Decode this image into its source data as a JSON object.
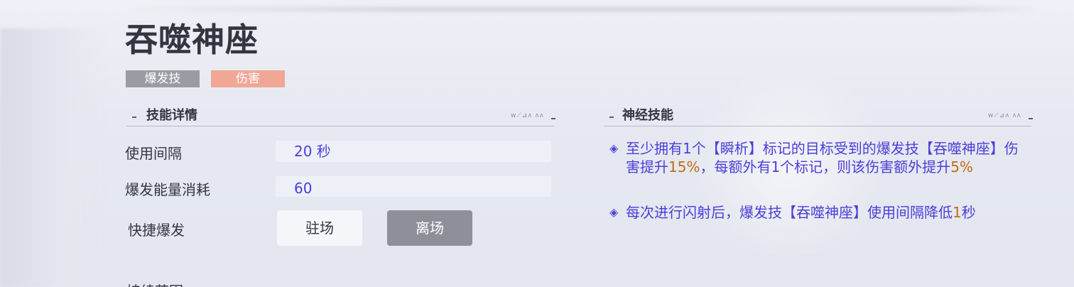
{
  "skill": {
    "title": "吞噬神座",
    "tags": [
      "爆发技",
      "伤害"
    ]
  },
  "details": {
    "header": "技能详情",
    "header_deco": "ᴡ⟋⊿ᴧ ᴧᴧ",
    "interval_label": "使用间隔",
    "interval_value": "20 秒",
    "energy_label": "爆发能量消耗",
    "energy_value": "60",
    "quick_label": "快捷爆发",
    "stay_button": "驻场",
    "leave_button": "离场",
    "next_section_label": "持续范围"
  },
  "neural": {
    "header": "神经技能",
    "header_deco": "ᴡ⟋⊿ᴧ ᴧᴧ",
    "bullet_glyph": "◈",
    "effect1": {
      "part1": "至少拥有1个【瞬析】标记的目标受到的爆发技【吞噬神座】伤害提升",
      "hl1": "15%",
      "part2": "，每额外有1个标记，则该伤害额外提升",
      "hl2": "5%"
    },
    "effect2": {
      "part1": "每次进行闪射后，爆发技【吞噬神座】使用间隔降低",
      "hl1": "1",
      "part2": "秒"
    }
  },
  "colors": {
    "accent_text": "#4b3ed8",
    "highlight": "#c46a18",
    "tag_burst": "#9a9ba3",
    "tag_damage": "#f0a796",
    "button_active": "#8e9099"
  }
}
